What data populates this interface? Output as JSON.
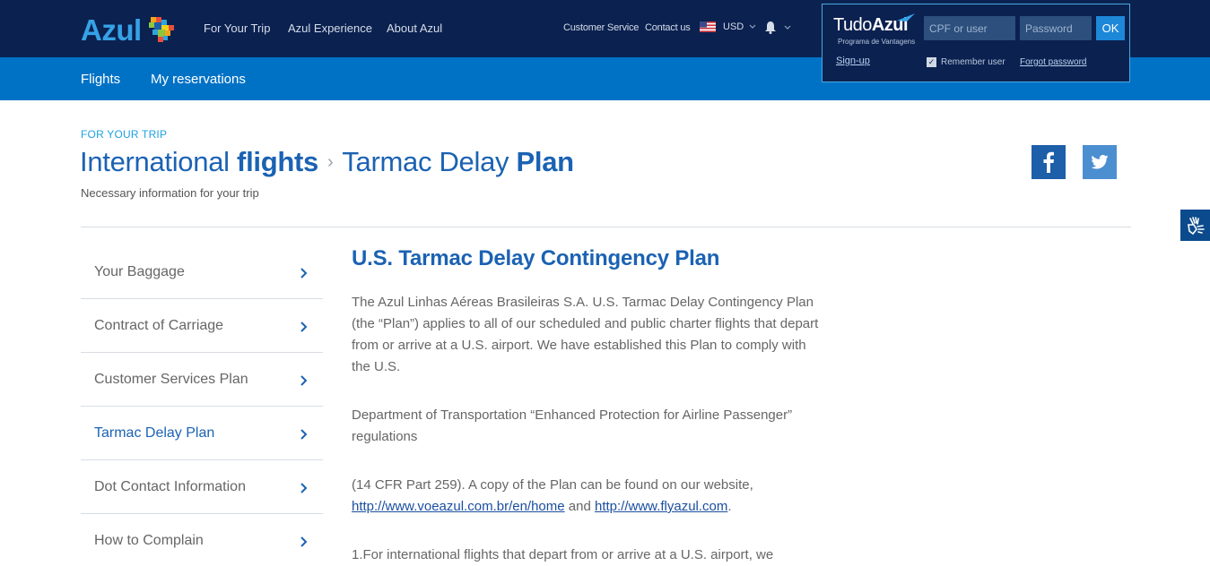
{
  "header": {
    "logo_text": "Azul",
    "nav": [
      "For Your Trip",
      "Azul Experience",
      "About Azul"
    ],
    "customer_service": "Customer Service",
    "contact_us": "Contact us",
    "currency": "USD"
  },
  "login": {
    "brand_light": "Tudo",
    "brand_bold": "Azul",
    "brand_sub": "Programa de Vantagens",
    "user_placeholder": "CPF or user",
    "password_placeholder": "Password",
    "ok_label": "OK",
    "signup": "Sign-up",
    "remember": "Remember user",
    "forgot": "Forgot password"
  },
  "subnav": [
    "Flights",
    "My reservations"
  ],
  "page": {
    "eyebrow": "FOR YOUR TRIP",
    "title_light_1": "International ",
    "title_bold_1": "flights",
    "title_sep": "›",
    "title_light_2": "Tarmac Delay ",
    "title_bold_2": "Plan",
    "subtitle": "Necessary information for your trip"
  },
  "sidemenu": [
    {
      "label": "Your Baggage",
      "active": false
    },
    {
      "label": "Contract of Carriage",
      "active": false
    },
    {
      "label": "Customer Services Plan",
      "active": false
    },
    {
      "label": "Tarmac Delay Plan",
      "active": true
    },
    {
      "label": "Dot Contact Information",
      "active": false
    },
    {
      "label": "How to Complain",
      "active": false
    }
  ],
  "content": {
    "heading": "U.S. Tarmac Delay Contingency Plan",
    "p1": "The Azul Linhas Aéreas Brasileiras S.A. U.S. Tarmac Delay Contingency Plan (the “Plan”) applies to all of our scheduled and public charter flights that depart from or arrive at a U.S. airport. We have established this Plan to comply with the U.S.",
    "p2": "Department of Transportation “Enhanced Protection for Airline Passenger” regulations",
    "p3_pre": "(14 CFR Part 259). A copy of the Plan can be found on our website, ",
    "p3_link1": "http://www.voeazul.com.br/en/home",
    "p3_mid": " and ",
    "p3_link2": "http://www.flyazul.com",
    "p3_post": ".",
    "p4": "1.For international flights that depart from or arrive at a U.S. airport, we"
  },
  "colors": {
    "topbar": "#0b2150",
    "subnav": "#0072c6",
    "title": "#1b62b3",
    "accent": "#1fa0e0"
  }
}
